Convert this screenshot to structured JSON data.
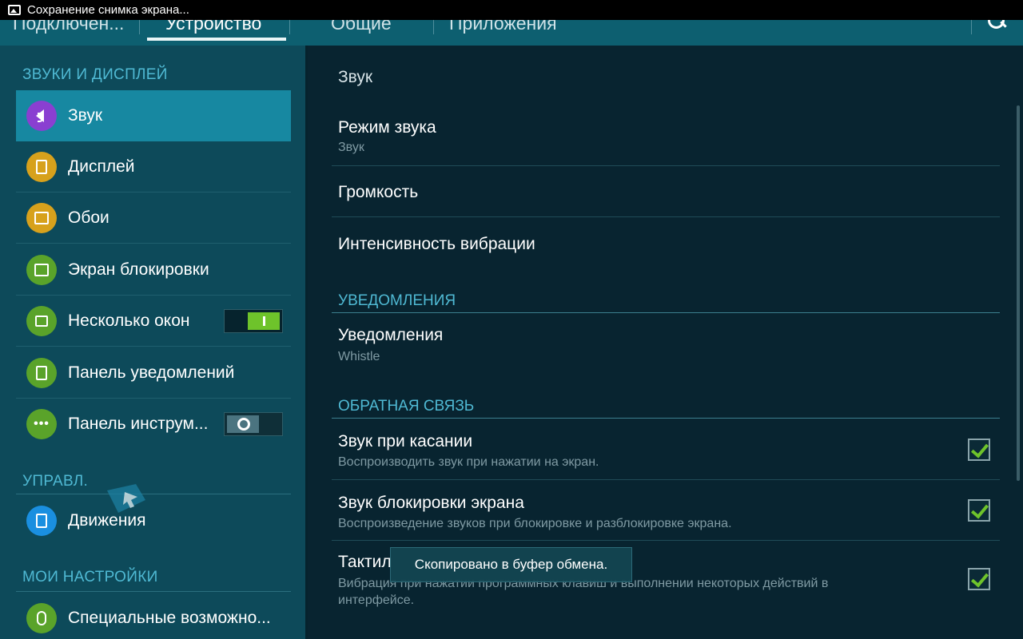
{
  "status_bar": {
    "text": "Сохранение снимка экрана..."
  },
  "tabs": [
    {
      "label": "Подключен..."
    },
    {
      "label": "Устройство",
      "active": true
    },
    {
      "label": "Общие"
    },
    {
      "label": "Приложения"
    }
  ],
  "left": {
    "section1": "ЗВУКИ И ДИСПЛЕЙ",
    "items": [
      {
        "label": "Звук",
        "icon": "speaker-icon",
        "color": "#8a3fd1"
      },
      {
        "label": "Дисплей",
        "icon": "display-icon",
        "color": "#d7a11c"
      },
      {
        "label": "Обои",
        "icon": "wallpaper-icon",
        "color": "#d7a11c"
      },
      {
        "label": "Экран блокировки",
        "icon": "lock-screen-icon",
        "color": "#5aa32a"
      },
      {
        "label": "Несколько окон",
        "icon": "multi-window-icon",
        "color": "#5aa32a",
        "toggle": "on"
      },
      {
        "label": "Панель уведомлений",
        "icon": "notification-panel-icon",
        "color": "#5aa32a"
      },
      {
        "label": "Панель инструм...",
        "icon": "toolbox-icon",
        "color": "#5aa32a",
        "toggle": "off"
      }
    ],
    "section2": "УПРАВЛ.",
    "motion": {
      "label": "Движения",
      "icon": "motion-icon",
      "color": "#1a8fe0"
    },
    "section3": "МОИ НАСТРОЙКИ",
    "accessibility": {
      "label": "Специальные возможно...",
      "icon": "hand-icon",
      "color": "#5aa32a"
    }
  },
  "right": {
    "header": "Звук",
    "rows": [
      {
        "title": "Режим звука",
        "subtitle": "Звук"
      },
      {
        "title": "Громкость"
      },
      {
        "title": "Интенсивность вибрации"
      }
    ],
    "notifications_section": "УВЕДОМЛЕНИЯ",
    "notifications_row": {
      "title": "Уведомления",
      "subtitle": "Whistle"
    },
    "feedback_section": "ОБРАТНАЯ СВЯЗЬ",
    "feedback_rows": [
      {
        "title": "Звук при касании",
        "subtitle": "Воспроизводить звук при нажатии на экран.",
        "checked": true
      },
      {
        "title": "Звук блокировки экрана",
        "subtitle": "Воспроизведение звуков при блокировке и разблокировке экрана.",
        "checked": true
      },
      {
        "title": "Тактил",
        "subtitle": "Вибрация при нажатии программных клавиш и выполнении некоторых действий в",
        "subtitle2": "интерфейсе.",
        "checked": true
      }
    ]
  },
  "toast": {
    "text": "Скопировано в буфер обмена."
  },
  "colors": {
    "accent": "#4fb9d3",
    "active_item": "#1788a1",
    "toggle_on": "#6ec32b"
  }
}
